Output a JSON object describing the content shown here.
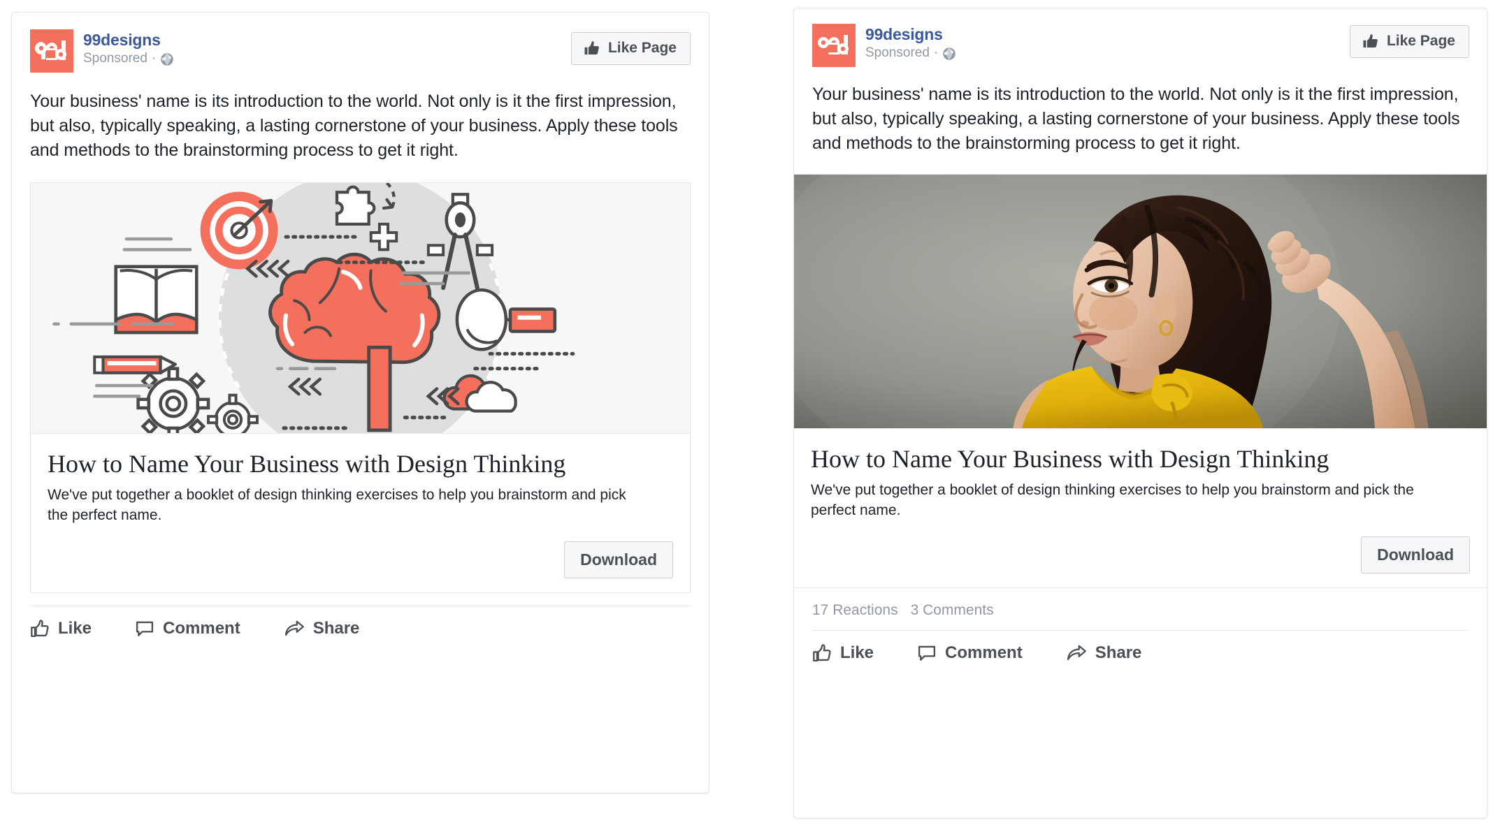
{
  "brand": {
    "accent_orange": "#f4705c",
    "link_blue": "#3b5998",
    "text_dark": "#1d2129",
    "text_muted": "#9197a3",
    "button_text": "#4b4f56"
  },
  "post": {
    "page_name": "99designs",
    "sponsored_label": "Sponsored",
    "separator": "·",
    "privacy_icon": "globe-icon",
    "avatar_text": "99d",
    "like_page_label": "Like Page",
    "body_text": "Your business' name is its introduction to the world. Not only is it the first impression, but also, typically speaking, a lasting cornerstone of your business. Apply these tools and methods to the brainstorming process to get it right."
  },
  "link_preview": {
    "title": "How to Name Your Business with Design Thinking",
    "description": "We've put together a booklet of design thinking exercises to help you brainstorm and pick the perfect name.",
    "cta_label": "Download"
  },
  "actions": [
    {
      "label": "Like",
      "icon": "thumbs-up-outline-icon"
    },
    {
      "label": "Comment",
      "icon": "speech-bubble-icon"
    },
    {
      "label": "Share",
      "icon": "share-arrow-icon"
    }
  ],
  "cards": {
    "left": {
      "media_type": "illustration",
      "media_alt": "Brain surrounded by design thinking icons: target with arrow, open book, drafting compass, puzzle piece, gears, magnifying glass, pencil, cloud",
      "has_reactions": false
    },
    "right": {
      "media_type": "photo",
      "media_alt": "Woman in yellow sleeveless top with dark curly hair scratching her head against a gray wall",
      "has_reactions": true,
      "reactions_count": "17 Reactions",
      "comments_count": "3 Comments"
    }
  }
}
